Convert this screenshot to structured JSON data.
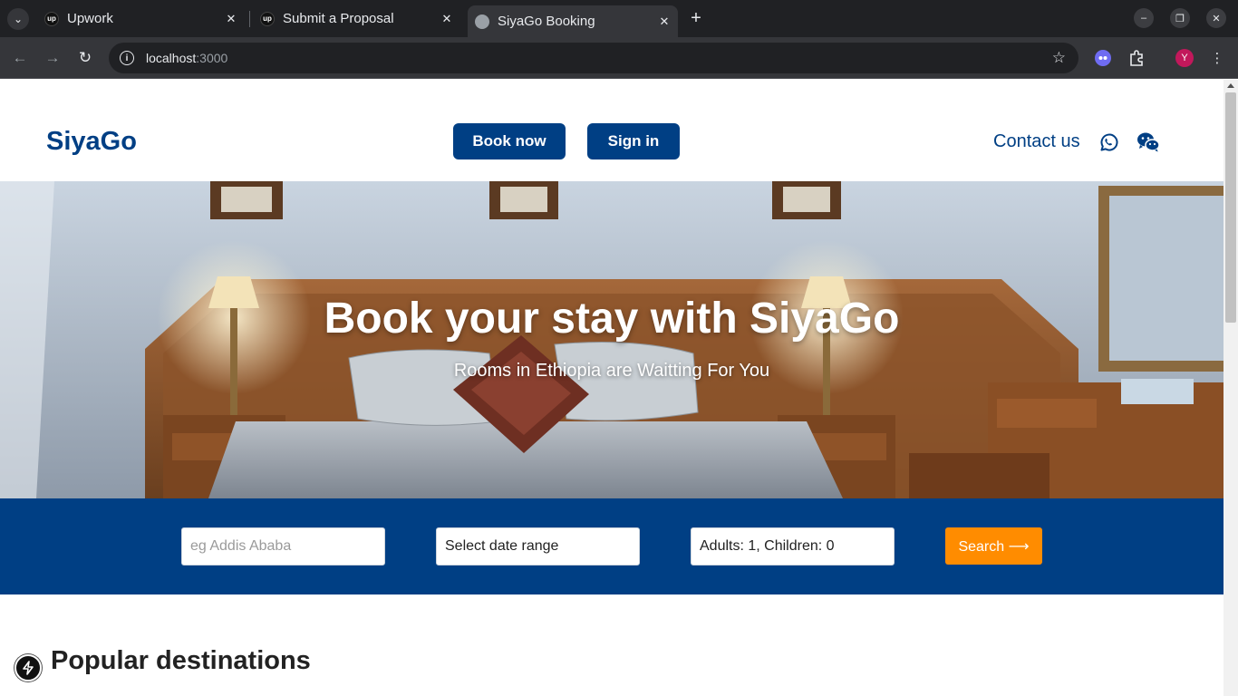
{
  "browser": {
    "tabs": [
      {
        "title": "Upwork",
        "favicon": "upwork-icon",
        "active": false
      },
      {
        "title": "Submit a Proposal",
        "favicon": "upwork-icon",
        "active": false
      },
      {
        "title": "SiyaGo Booking",
        "favicon": "globe-icon",
        "active": true
      }
    ],
    "address": {
      "host": "localhost",
      "port": ":3000"
    },
    "profile_initial": "Y"
  },
  "header": {
    "logo": "SiyaGo",
    "book_now": "Book now",
    "sign_in": "Sign in",
    "contact": "Contact us",
    "social_icons": [
      "whatsapp-icon",
      "wechat-icon"
    ]
  },
  "hero": {
    "title": "Book your stay with SiyaGo",
    "subtitle": "Rooms in Ethiopia are Waitting For You"
  },
  "search": {
    "destination_placeholder": "eg Addis Ababa",
    "date_range": "Select date range",
    "guests": "Adults: 1, Children: 0",
    "button": "Search ⟶"
  },
  "sections": {
    "popular_title": "Popular destinations"
  },
  "colors": {
    "brand": "#003f84",
    "accent": "#ff8c00"
  }
}
